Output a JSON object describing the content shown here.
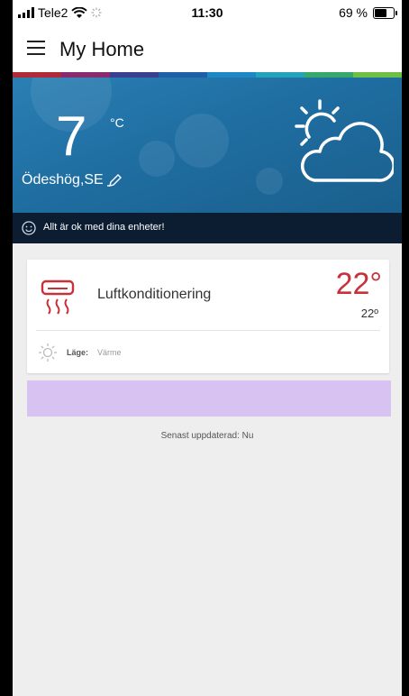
{
  "status_bar": {
    "carrier": "Tele2",
    "time": "11:30",
    "battery": "69 %",
    "battery_level": 0.69
  },
  "header": {
    "title": "My Home"
  },
  "rainbow_colors": [
    "#b02a37",
    "#8a2a6f",
    "#3a3f8f",
    "#1f5fa8",
    "#1e88c7",
    "#25a3b9",
    "#36a96a",
    "#6fbf45"
  ],
  "weather": {
    "temperature": "7",
    "unit": "°C",
    "location": "Ödeshög,SE",
    "icon": "partly-cloudy-icon"
  },
  "status_message": "Allt är ok med dina enheter!",
  "device": {
    "name": "Luftkonditionering",
    "set_temperature": "22°",
    "current_temperature": "22º",
    "mode_label": "Läge:",
    "mode_value": "Värme",
    "accent_color": "#c8303a"
  },
  "footer": {
    "last_updated": "Senast uppdaterad: Nu"
  }
}
